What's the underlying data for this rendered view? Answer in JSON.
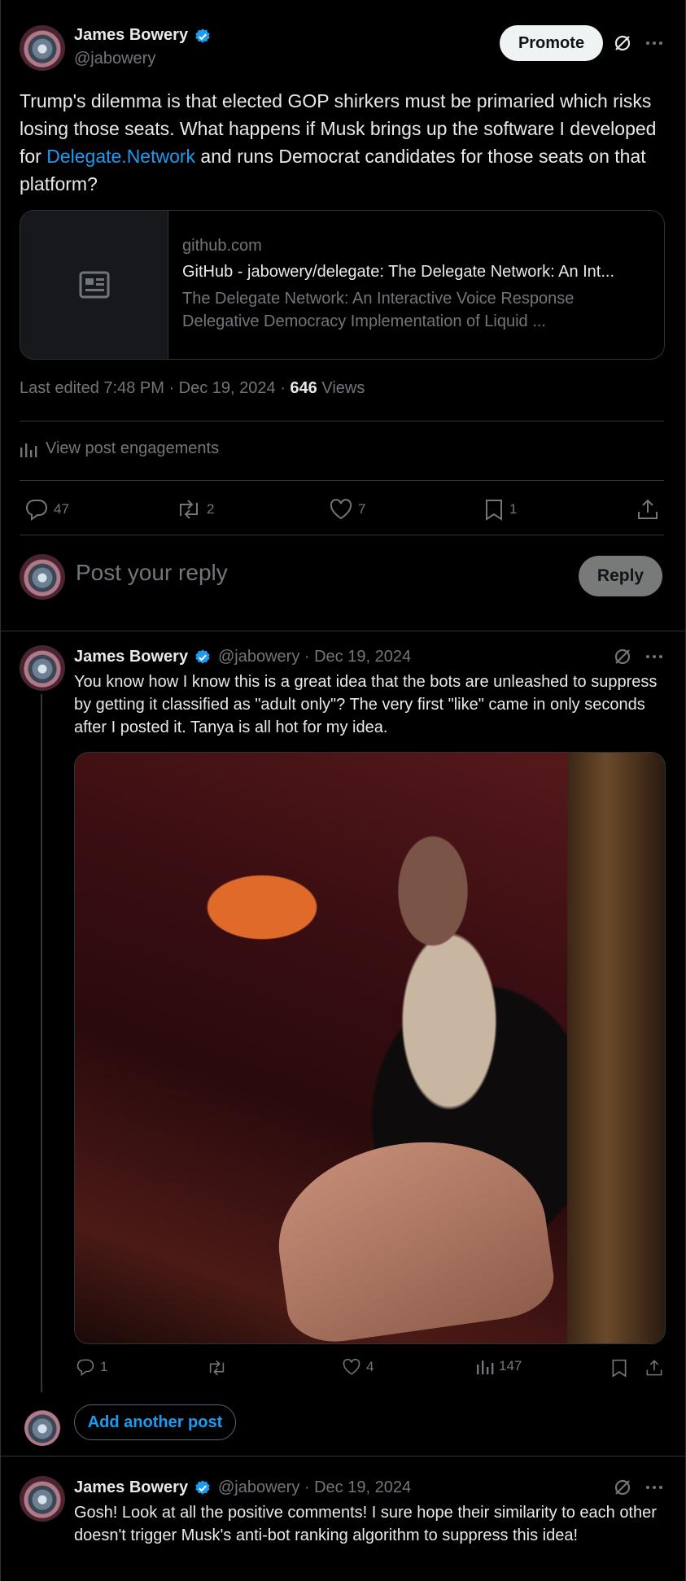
{
  "main_post": {
    "author_name": "James Bowery",
    "author_handle": "@jabowery",
    "promote_label": "Promote",
    "text_before_link": "Trump's dilemma is that elected GOP shirkers must be primaried which risks losing those seats.  What happens if Musk brings up the software I developed for ",
    "link_text": "Delegate.Network",
    "text_after_link": " and runs Democrat candidates for those seats on that platform?",
    "card": {
      "domain": "github.com",
      "title": "GitHub - jabowery/delegate: The Delegate Network: An Int...",
      "description": "The Delegate Network: An Interactive Voice Response Delegative Democracy Implementation of Liquid ..."
    },
    "meta_prefix": "Last edited 7:48 PM · Dec 19, 2024 · ",
    "views_count": "646",
    "views_label": " Views",
    "engagements_label": "View post engagements",
    "stats": {
      "replies": "47",
      "reposts": "2",
      "likes": "7",
      "bookmarks": "1"
    }
  },
  "reply_box": {
    "placeholder": "Post your reply",
    "reply_label": "Reply"
  },
  "thread_reply_1": {
    "author_name": "James Bowery",
    "handle_date": "@jabowery · Dec 19, 2024",
    "text": "You know how I know this is a great idea that the bots are unleashed to suppress by getting it classified as \"adult only\"? The very first \"like\" came in only seconds after I posted it.  Tanya is all hot for my idea.",
    "stats": {
      "replies": "1",
      "likes": "4",
      "views": "147"
    }
  },
  "add_post_label": "Add another post",
  "thread_reply_2": {
    "author_name": "James Bowery",
    "handle_date": "@jabowery · Dec 19, 2024",
    "text": "Gosh!  Look at all the positive comments!  I sure hope their similarity to each other doesn't trigger Musk's anti-bot ranking algorithm to suppress this idea!"
  },
  "colors": {
    "accent": "#1d9bf0",
    "background": "#000000",
    "muted": "#71767b",
    "border": "#2f3336"
  }
}
